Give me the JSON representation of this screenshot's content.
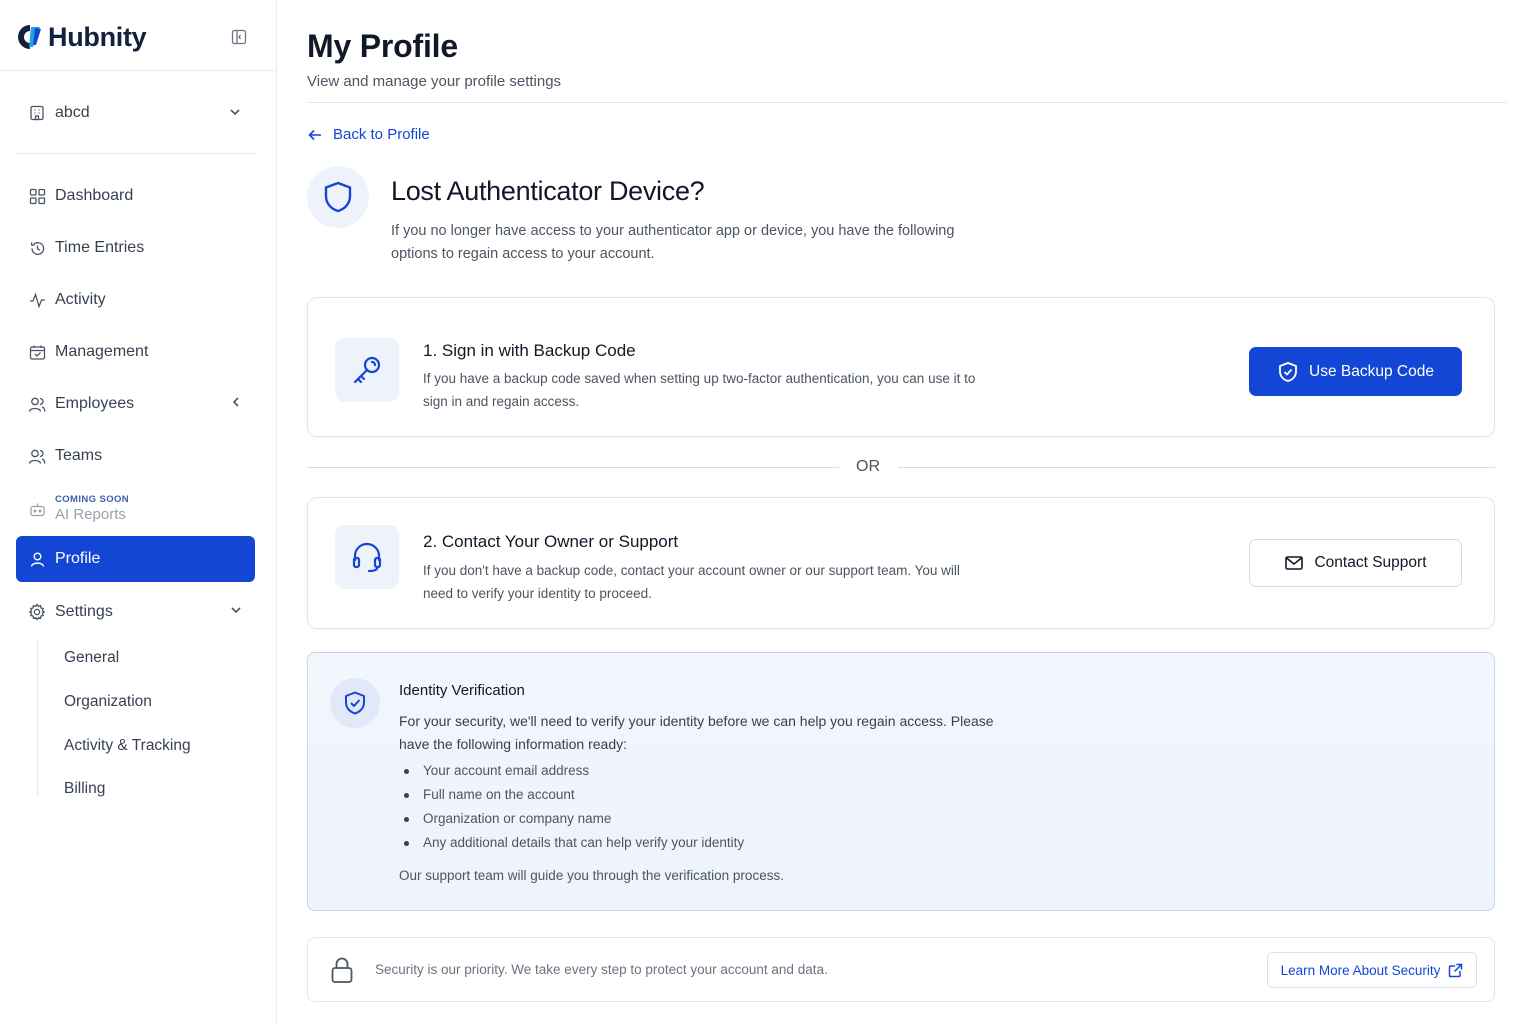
{
  "app": {
    "brand_name": "Hubnity",
    "colors": {
      "primary": "#1446d6",
      "text": "#111827",
      "muted": "#4b5563",
      "info_bg": "#eef3fc"
    }
  },
  "sidebar": {
    "workspace": {
      "label": "abcd",
      "icon": "building-icon"
    },
    "items": [
      {
        "label": "Dashboard",
        "icon": "grid-icon"
      },
      {
        "label": "Time Entries",
        "icon": "history-icon"
      },
      {
        "label": "Activity",
        "icon": "activity-icon"
      },
      {
        "label": "Management",
        "icon": "calendar-icon"
      },
      {
        "label": "Employees",
        "icon": "users-icon"
      },
      {
        "label": "Teams",
        "icon": "users-icon"
      },
      {
        "label": "AI Reports",
        "badge": "COMING SOON",
        "icon": "bot-icon"
      },
      {
        "label": "Profile",
        "icon": "user-icon",
        "active": true
      },
      {
        "label": "Settings",
        "icon": "gear-icon"
      }
    ],
    "settings_sub": [
      "General",
      "Organization",
      "Activity & Tracking",
      "Billing"
    ]
  },
  "header": {
    "title": "My Profile",
    "subtitle": "View and manage your profile settings"
  },
  "back_link": "Back to Profile",
  "hero": {
    "title": "Lost Authenticator Device?",
    "description": "If you no longer have access to your authenticator app or device, you have the following options to regain access to your account."
  },
  "option1": {
    "title": "1. Sign in with Backup Code",
    "description": "If you have a backup code saved when setting up two-factor authentication, you can use it to sign in and regain access.",
    "button": "Use Backup Code"
  },
  "divider_text": "OR",
  "option2": {
    "title": "2. Contact Your Owner or Support",
    "description": "If you don't have a backup code, contact your account owner or our support team. You will need to verify your identity to proceed.",
    "button": "Contact Support"
  },
  "identity": {
    "title": "Identity Verification",
    "paragraph": "For your security, we'll need to verify your identity before we can help you regain access. Please have the following information ready:",
    "bullets": [
      "Your account email address",
      "Full name on the account",
      "Organization or company name",
      "Any additional details that can help verify your identity"
    ],
    "footer": "Our support team will guide you through the verification process."
  },
  "security": {
    "text": "Security is our priority. We take every step to protect your account and data.",
    "button": "Learn More About Security"
  }
}
